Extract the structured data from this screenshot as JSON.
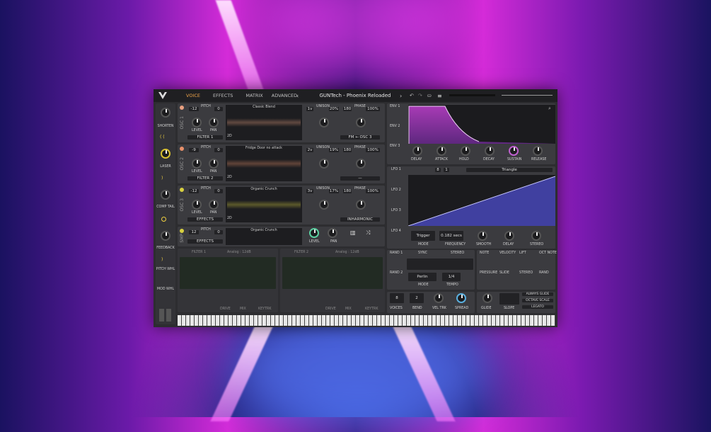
{
  "header": {
    "tabs": [
      "VOICE",
      "EFFECTS",
      "MATRIX",
      "ADVANCED"
    ],
    "preset_name": "GUNTech - Phoenix Reloaded"
  },
  "macros": [
    {
      "label": "SHORTEN"
    },
    {
      "label": "LASER"
    },
    {
      "label": "COMP TAIL"
    },
    {
      "label": "FEEDBACK"
    }
  ],
  "side_labels": [
    "PITCH WHL",
    "MOD WHL"
  ],
  "oscillators": [
    {
      "id": "OSC 1",
      "pitch_label": "PITCH",
      "pitch_val": "-12",
      "fine": "0",
      "wave_name": "Classic Blend",
      "dim": "2D",
      "level": "LEVEL",
      "pan": "PAN",
      "route": "FILTER 1",
      "unison_voices": "1v",
      "unison_label": "UNISON",
      "unison_pct": "20%",
      "phase_val": "180",
      "phase_label": "PHASE",
      "phase_pct": "100%",
      "bottom": "FM ← OSC 3"
    },
    {
      "id": "OSC 2",
      "pitch_label": "PITCH",
      "pitch_val": "-9",
      "fine": "0",
      "wave_name": "Fridge Door no attack",
      "dim": "2D",
      "level": "LEVEL",
      "pan": "PAN",
      "route": "FILTER 2",
      "unison_voices": "2v",
      "unison_label": "UNISON",
      "unison_pct": "19%",
      "phase_val": "180",
      "phase_label": "PHASE",
      "phase_pct": "100%",
      "bottom": "—"
    },
    {
      "id": "OSC 3",
      "pitch_label": "PITCH",
      "pitch_val": "-12",
      "fine": "0",
      "wave_name": "Organic Crunch",
      "dim": "2D",
      "level": "LEVEL",
      "pan": "PAN",
      "route": "EFFECTS",
      "unison_voices": "3v",
      "unison_label": "UNISON",
      "unison_pct": "17%",
      "phase_val": "180",
      "phase_label": "PHASE",
      "phase_pct": "100%",
      "bottom": "INHARMONIC"
    }
  ],
  "sampler": {
    "id": "SMP",
    "pitch_label": "PITCH",
    "pitch_val": "12",
    "fine": "0",
    "name": "Organic Crunch",
    "route": "EFFECTS",
    "level": "LEVEL",
    "pan": "PAN"
  },
  "filters": [
    {
      "title": "FILTER 1",
      "model": "Analog : 12dB",
      "knobs": [
        "DRIVE",
        "MIX",
        "KEYTRK"
      ]
    },
    {
      "title": "FILTER 2",
      "model": "Analog : 12dB",
      "knobs": [
        "DRIVE",
        "MIX",
        "KEYTRK"
      ]
    }
  ],
  "envelopes": {
    "tabs": [
      "ENV 1",
      "ENV 2",
      "ENV 3"
    ],
    "knobs": [
      "DELAY",
      "ATTACK",
      "HOLD",
      "DECAY",
      "SUSTAIN",
      "RELEASE"
    ]
  },
  "lfo": {
    "tabs": [
      "LFO 1",
      "LFO 2",
      "LFO 3",
      "LFO 4"
    ],
    "grid_x": "8",
    "grid_y": "1",
    "shape": "Triangle",
    "mode_val": "Trigger",
    "mode_label": "MODE",
    "freq_val": "0.182 secs",
    "freq_label": "FREQUENCY",
    "knobs": [
      "SMOOTH",
      "DELAY",
      "STEREO"
    ]
  },
  "random": {
    "tabs": [
      "RAND 1",
      "RAND 2"
    ],
    "sync": "SYNC",
    "stereo": "STEREO",
    "mode_val": "Perlin",
    "mode_label": "MODE",
    "tempo_val": "1/4",
    "tempo_label": "TEMPO"
  },
  "mod_sources": [
    "NOTE",
    "VELOCITY",
    "LIFT",
    "OCT NOTE",
    "PRESSURE",
    "SLIDE",
    "STEREO",
    "RAND"
  ],
  "voice": {
    "voices_val": "8",
    "voices_label": "VOICES",
    "bend_val": "2",
    "bend_label": "BEND",
    "veltrk": "VEL TRK",
    "spread": "SPREAD",
    "glide": "GLIDE",
    "slope": "SLOPE",
    "opts": [
      "ALWAYS GLIDE",
      "OCTAVE SCALE",
      "LEGATO"
    ]
  }
}
